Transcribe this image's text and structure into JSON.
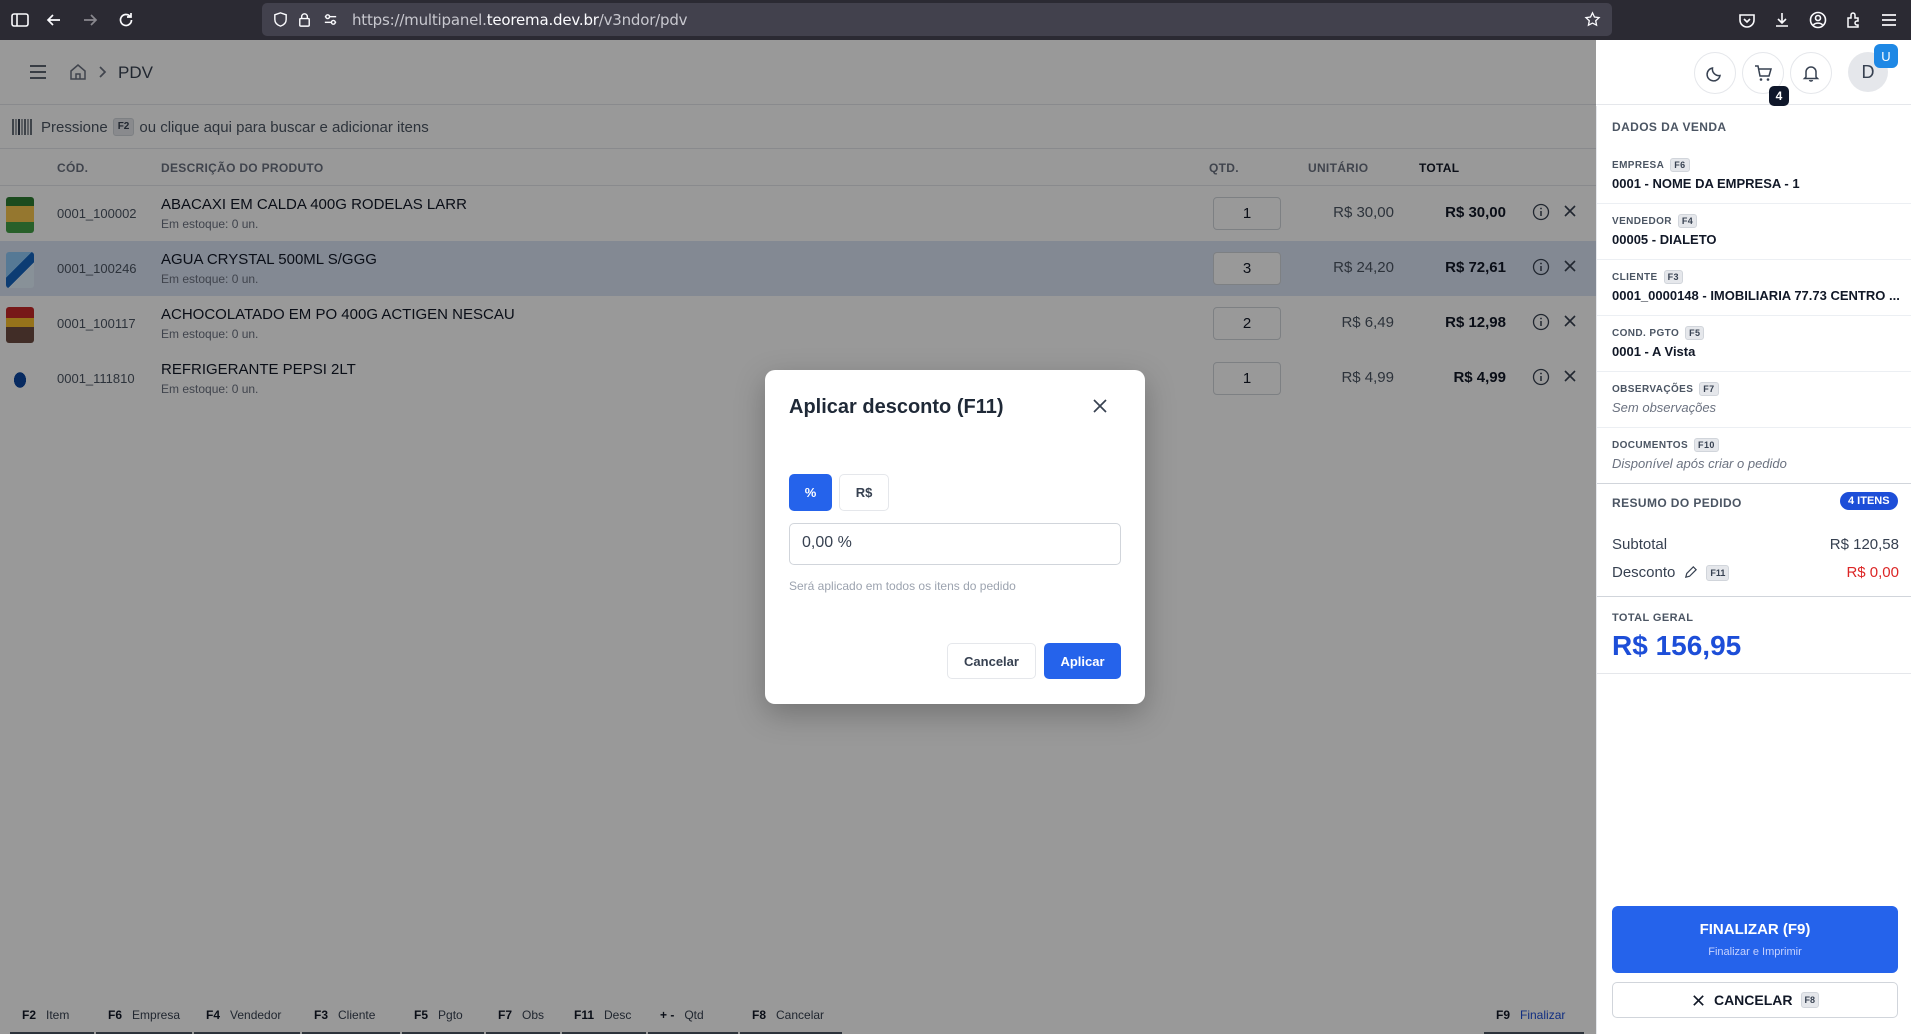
{
  "browser": {
    "url_prefix": "https://multipanel.",
    "url_domain": "teorema.dev.br",
    "url_path": "/v3ndor/pdv"
  },
  "header": {
    "breadcrumb": "PDV",
    "cart_count": "4",
    "avatar_initial": "D",
    "avatar_badge": "U"
  },
  "search": {
    "prefix": "Pressione",
    "key": "F2",
    "suffix": "ou clique aqui para buscar e adicionar itens"
  },
  "table": {
    "headers": {
      "code": "CÓD.",
      "desc": "DESCRIÇÃO DO PRODUTO",
      "qty": "QTD.",
      "unit": "UNITÁRIO",
      "total": "TOTAL"
    },
    "rows": [
      {
        "code": "0001_100002",
        "name": "ABACAXI EM CALDA 400G RODELAS LARR",
        "stock": "Em estoque: 0 un.",
        "qty": "1",
        "unit": "R$ 30,00",
        "total": "R$ 30,00"
      },
      {
        "code": "0001_100246",
        "name": "AGUA CRYSTAL 500ML S/GGG",
        "stock": "Em estoque: 0 un.",
        "qty": "3",
        "unit": "R$ 24,20",
        "total": "R$ 72,61"
      },
      {
        "code": "0001_100117",
        "name": "ACHOCOLATADO EM PO 400G ACTIGEN NESCAU",
        "stock": "Em estoque: 0 un.",
        "qty": "2",
        "unit": "R$ 6,49",
        "total": "R$ 12,98"
      },
      {
        "code": "0001_111810",
        "name": "REFRIGERANTE PEPSI 2LT",
        "stock": "Em estoque: 0 un.",
        "qty": "1",
        "unit": "R$ 4,99",
        "total": "R$ 4,99"
      }
    ]
  },
  "shortcuts": [
    {
      "key": "F2",
      "label": "Item"
    },
    {
      "key": "F6",
      "label": "Empresa"
    },
    {
      "key": "F4",
      "label": "Vendedor"
    },
    {
      "key": "F3",
      "label": "Cliente"
    },
    {
      "key": "F5",
      "label": "Pgto"
    },
    {
      "key": "F7",
      "label": "Obs"
    },
    {
      "key": "F11",
      "label": "Desc"
    },
    {
      "key": "+ -",
      "label": "Qtd"
    },
    {
      "key": "F8",
      "label": "Cancelar"
    },
    {
      "key": "F9",
      "label": "Finalizar"
    }
  ],
  "sale": {
    "title": "DADOS DA VENDA",
    "fields": [
      {
        "label": "EMPRESA",
        "key": "F6",
        "value": "0001 - NOME DA EMPRESA - 1"
      },
      {
        "label": "VENDEDOR",
        "key": "F4",
        "value": "00005 - DIALETO"
      },
      {
        "label": "CLIENTE",
        "key": "F3",
        "value": "0001_0000148 - IMOBILIARIA 77.73 CENTRO ..."
      },
      {
        "label": "COND. PGTO",
        "key": "F5",
        "value": "0001 - A Vista"
      },
      {
        "label": "OBSERVAÇÕES",
        "key": "F7",
        "value": "Sem observações"
      },
      {
        "label": "DOCUMENTOS",
        "key": "F10",
        "value": "Disponível após criar o pedido"
      }
    ]
  },
  "summary": {
    "title": "RESUMO DO PEDIDO",
    "items_badge": "4 ITENS",
    "subtotal_label": "Subtotal",
    "subtotal": "R$ 120,58",
    "discount_label": "Desconto",
    "discount_key": "F11",
    "discount": "R$ 0,00",
    "grand_label": "TOTAL GERAL",
    "grand": "R$ 156,95"
  },
  "actions": {
    "finalize": "FINALIZAR (F9)",
    "finalize_sub": "Finalizar e Imprimir",
    "cancel": "CANCELAR",
    "cancel_key": "F8"
  },
  "modal": {
    "title": "Aplicar desconto (F11)",
    "toggle_percent": "%",
    "toggle_currency": "R$",
    "input_value": "0,00 %",
    "hint": "Será aplicado em todos os itens do pedido",
    "cancel": "Cancelar",
    "apply": "Aplicar"
  },
  "colors": {
    "primary": "#2563eb",
    "danger": "#dc2626"
  }
}
